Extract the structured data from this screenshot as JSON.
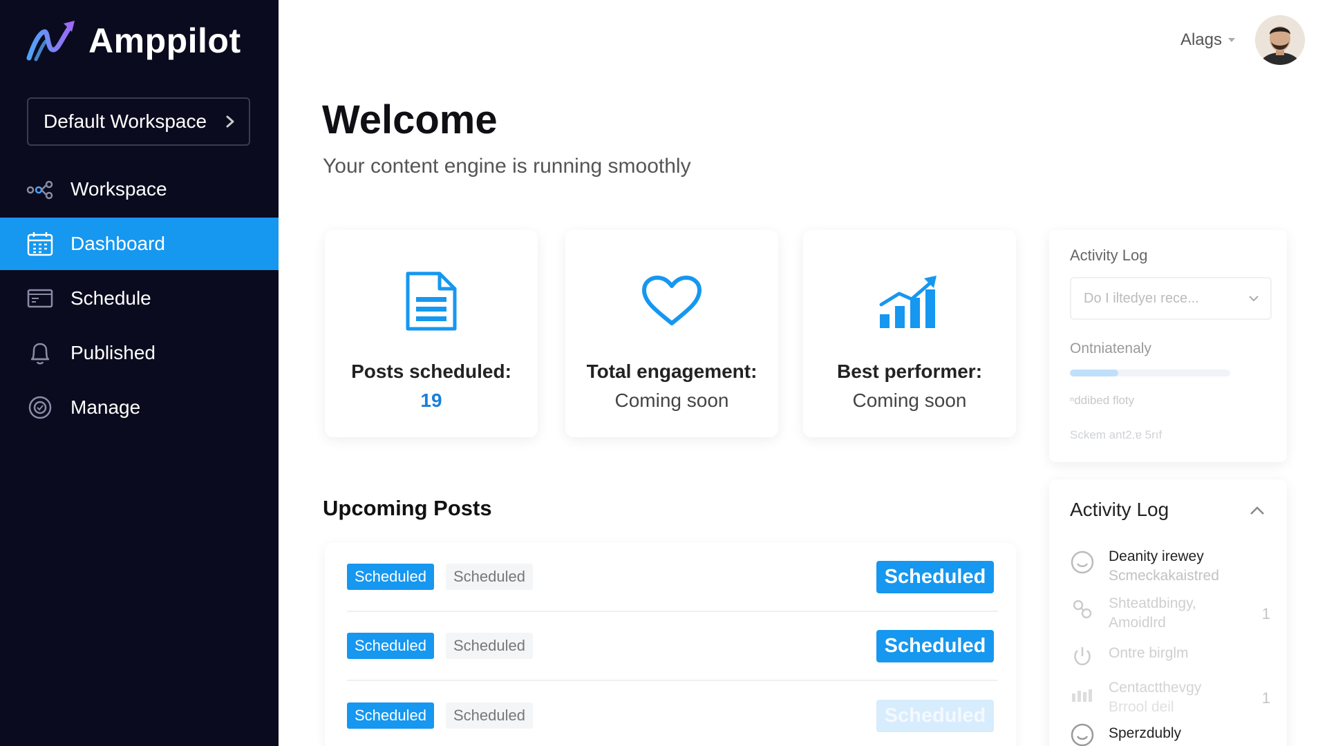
{
  "app": {
    "name": "Amppilot"
  },
  "workspace_selector": {
    "label": "Default Workspace"
  },
  "sidebar": {
    "items": [
      {
        "label": "Workspace",
        "icon": "nodes-icon",
        "active": false
      },
      {
        "label": "Dashboard",
        "icon": "calendar-grid-icon",
        "active": true
      },
      {
        "label": "Schedule",
        "icon": "window-icon",
        "active": false
      },
      {
        "label": "Published",
        "icon": "bell-icon",
        "active": false
      },
      {
        "label": "Manage",
        "icon": "gear-shield-icon",
        "active": false
      }
    ]
  },
  "user": {
    "name": "Alags"
  },
  "header": {
    "title": "Welcome",
    "subtitle": "Your content engine is running smoothly"
  },
  "stats": [
    {
      "title": "Posts scheduled:",
      "value": "19",
      "icon": "document-icon"
    },
    {
      "title": "Total engagement:",
      "value": "Coming soon",
      "icon": "heart-icon"
    },
    {
      "title": "Best performer:",
      "value": "Coming soon",
      "icon": "bar-chart-up-icon"
    }
  ],
  "upcoming": {
    "title": "Upcoming Posts",
    "rows": [
      {
        "tag_primary": "Scheduled",
        "tag_secondary": "Scheduled",
        "button": "Scheduled",
        "button_faded": false
      },
      {
        "tag_primary": "Scheduled",
        "tag_secondary": "Scheduled",
        "button": "Scheduled",
        "button_faded": false
      },
      {
        "tag_primary": "Scheduled",
        "tag_secondary": "Scheduled",
        "button": "Scheduled",
        "button_faded": true
      }
    ]
  },
  "activity_panel_top": {
    "title": "Activity Log",
    "select_placeholder": "Do I iltedyeı rece...",
    "label": "Ontniatenaly",
    "progress": 0.3,
    "note1": "ⁿddibed floty",
    "note2": "Sckem ant2.ɐ 5rıf"
  },
  "activity_panel": {
    "title": "Activity Log",
    "items": [
      {
        "line1": "Deanity irewey",
        "line2": "Scmeckakaistred",
        "count": "",
        "icon": "smiley-icon"
      },
      {
        "line1": "Shteatdbingy,",
        "line2": "Amoidlrd",
        "count": "1",
        "icon": "links-icon"
      },
      {
        "line1": "Ontre birglm",
        "line2": "",
        "count": "",
        "icon": "power-icon"
      },
      {
        "line1": "Centactthevgy",
        "line2": "Brrool deil",
        "count": "1",
        "icon": "bars-icon"
      },
      {
        "line1": "Sperzdubly",
        "line2": "",
        "count": "",
        "icon": "smiley-icon"
      }
    ]
  },
  "colors": {
    "sidebar_bg": "#0a0b1e",
    "accent": "#1697f0",
    "value_blue": "#1a7ed8"
  }
}
